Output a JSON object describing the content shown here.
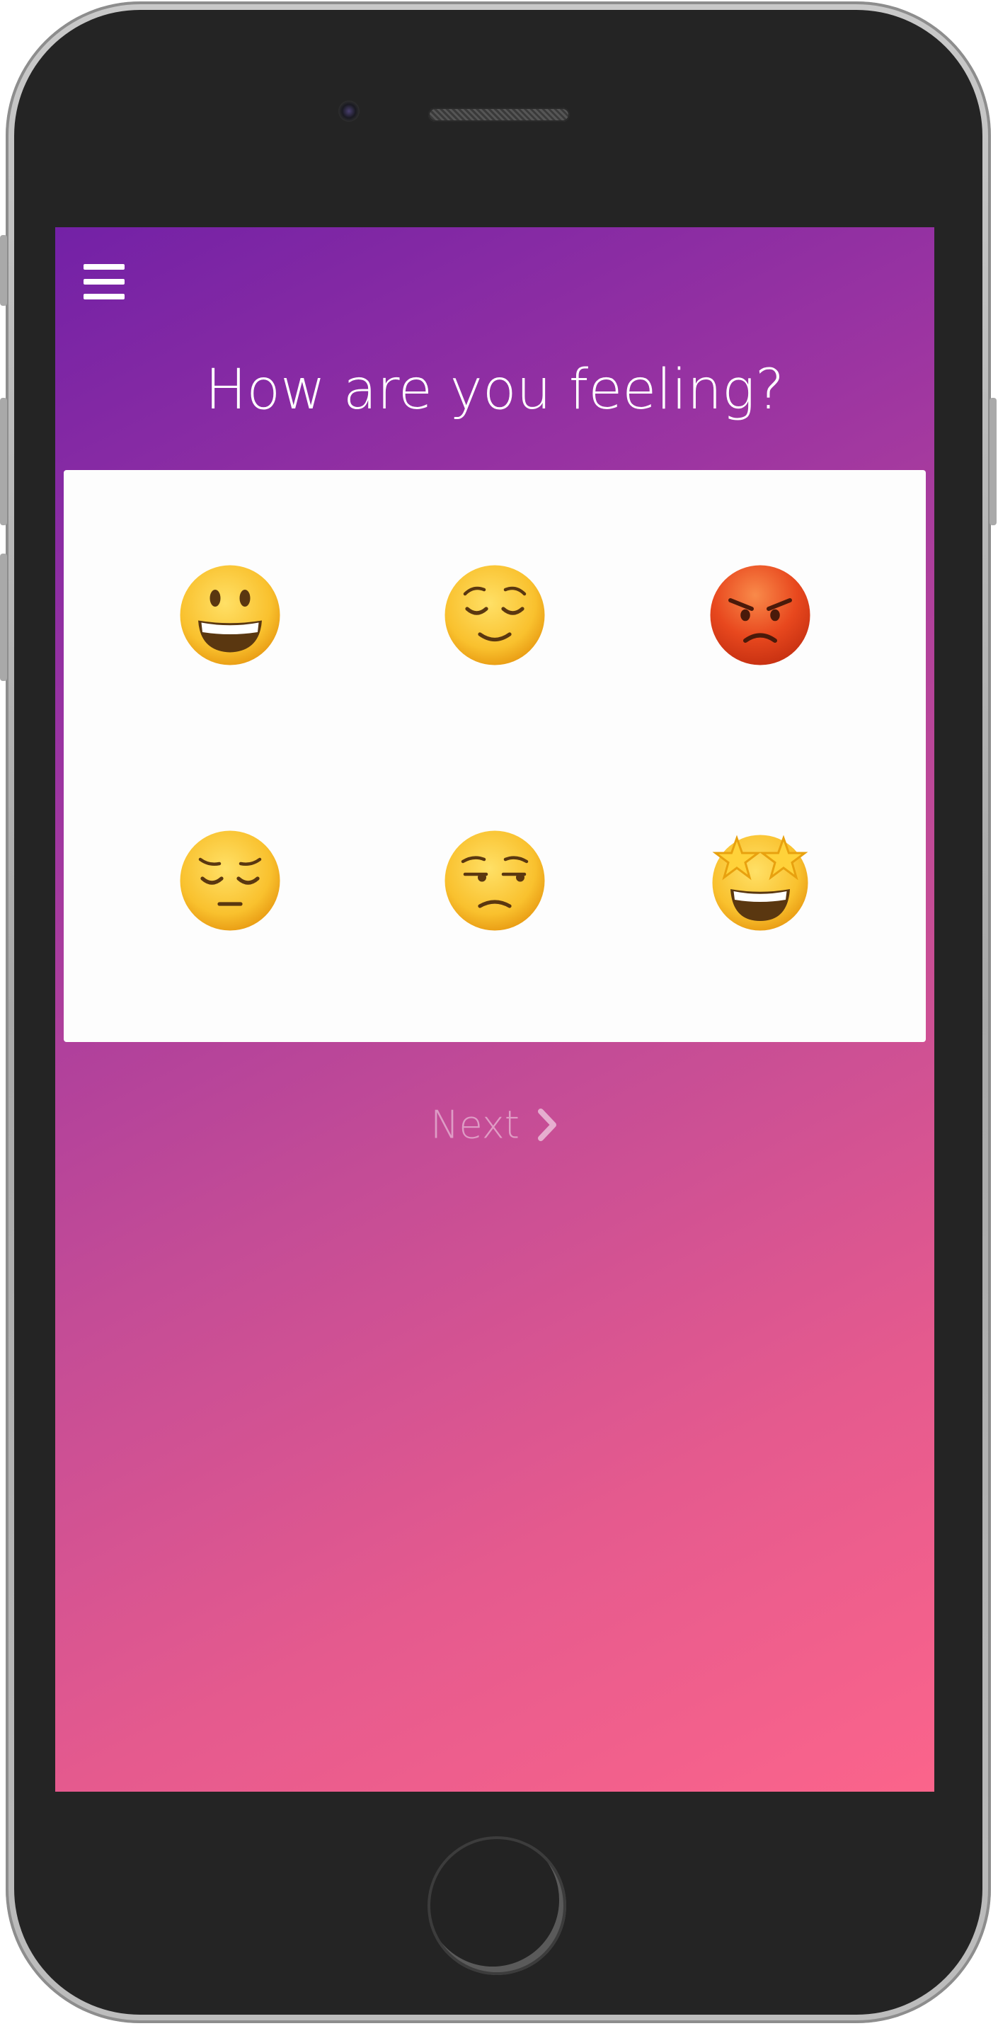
{
  "screen": {
    "title": "How are you feeling?",
    "menu_icon": "hamburger-menu-icon",
    "next_label": "Next",
    "next_icon": "chevron-right-icon"
  },
  "moods": [
    {
      "icon": "grinning-face-icon",
      "emoji": "😀"
    },
    {
      "icon": "relieved-face-icon",
      "emoji": "😌"
    },
    {
      "icon": "angry-face-icon",
      "emoji": "😡"
    },
    {
      "icon": "pensive-face-icon",
      "emoji": "😔"
    },
    {
      "icon": "unamused-face-icon",
      "emoji": "😒"
    },
    {
      "icon": "star-struck-icon",
      "emoji": "🤩"
    }
  ],
  "colors": {
    "gradient_start": "#7321a6",
    "gradient_end": "#fb648b",
    "card": "#fdfdfd",
    "emoji_yellow": "#f7b928",
    "angry_red": "#e8481e"
  }
}
